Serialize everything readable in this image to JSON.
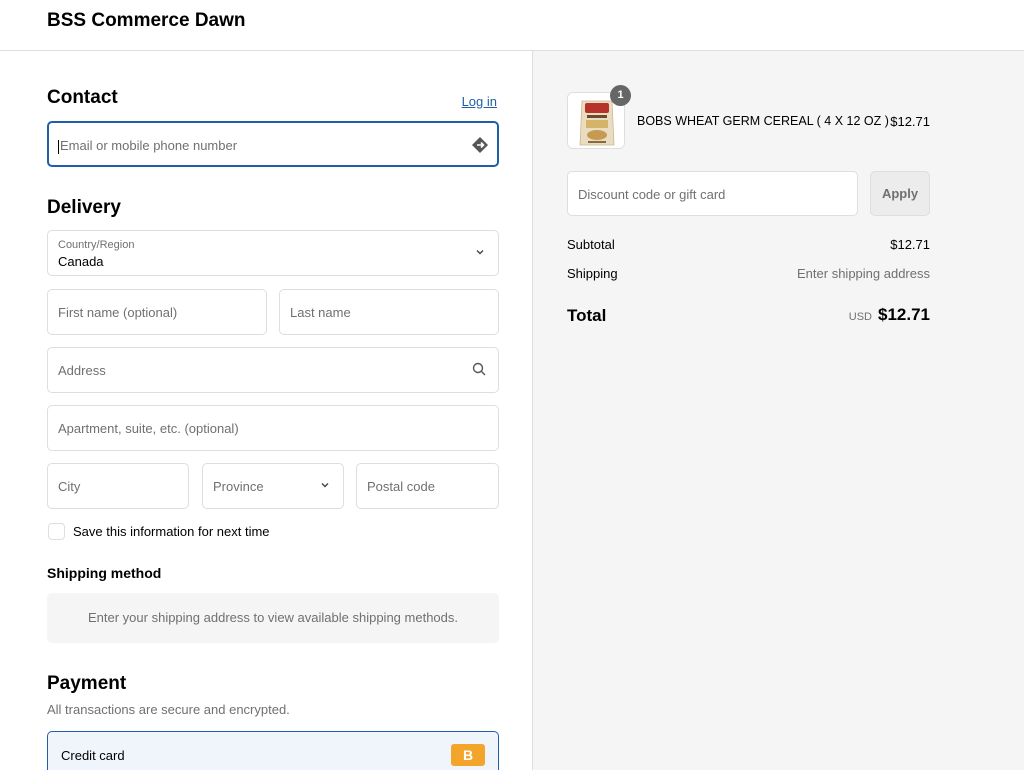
{
  "header": {
    "store_name": "BSS Commerce Dawn"
  },
  "contact": {
    "title": "Contact",
    "login_label": "Log in",
    "email_placeholder": "Email or mobile phone number"
  },
  "delivery": {
    "title": "Delivery",
    "country_label": "Country/Region",
    "country_value": "Canada",
    "first_name_placeholder": "First name (optional)",
    "last_name_placeholder": "Last name",
    "address_placeholder": "Address",
    "apartment_placeholder": "Apartment, suite, etc. (optional)",
    "city_placeholder": "City",
    "province_placeholder": "Province",
    "postal_placeholder": "Postal code",
    "save_info_label": "Save this information for next time"
  },
  "shipping_method": {
    "title": "Shipping method",
    "message": "Enter your shipping address to view available shipping methods."
  },
  "payment": {
    "title": "Payment",
    "subtitle": "All transactions are secure and encrypted.",
    "credit_card_label": "Credit card",
    "badge_letter": "B"
  },
  "summary": {
    "quantity": "1",
    "product_name": "BOBS WHEAT GERM CEREAL ( 4 X 12 OZ )",
    "product_price": "$12.71",
    "discount_placeholder": "Discount code or gift card",
    "apply_label": "Apply",
    "subtotal_label": "Subtotal",
    "subtotal_value": "$12.71",
    "shipping_label": "Shipping",
    "shipping_value": "Enter shipping address",
    "total_label": "Total",
    "currency": "USD",
    "total_value": "$12.71"
  },
  "colors": {
    "accent": "#1f5fa8",
    "badge": "#f3a52b",
    "summary_bg": "#f5f5f5"
  }
}
